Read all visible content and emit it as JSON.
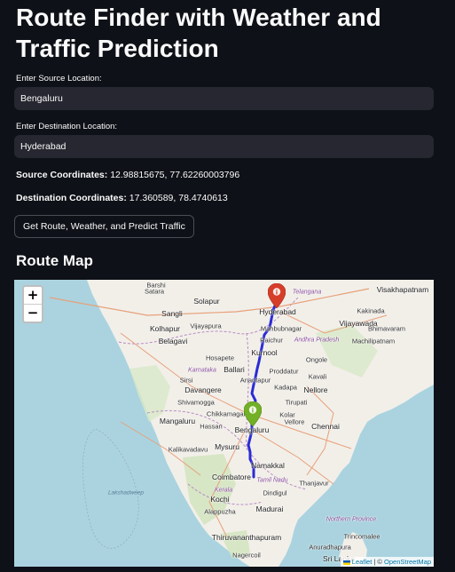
{
  "header": {
    "title": "Route Finder with Weather and Traffic Prediction"
  },
  "source": {
    "label": "Enter Source Location:",
    "value": "Bengaluru"
  },
  "destination": {
    "label": "Enter Destination Location:",
    "value": "Hyderabad"
  },
  "coordinates": {
    "source_label": "Source Coordinates:",
    "source_value": "12.98815675, 77.62260003796",
    "destination_label": "Destination Coordinates:",
    "destination_value": "17.360589, 78.4740613"
  },
  "action_button": {
    "label": "Get Route, Weather, and Predict Traffic"
  },
  "map_section": {
    "heading": "Route Map",
    "zoom_in": "+",
    "zoom_out": "−",
    "attribution": {
      "leaflet": "Leaflet",
      "separator": " | © ",
      "osm": "OpenStreetMap"
    },
    "start_marker_color": "#72b026",
    "end_marker_color": "#d63e2a",
    "route_color": "#2b2bd6",
    "places": {
      "barshi": "Barshi",
      "satara": "Satara",
      "telangana": "Telangana",
      "visakhapatnam": "Visakhapatnam",
      "solapur": "Solapur",
      "hyderabad": "Hyderabad",
      "sangli": "Sangli",
      "kakinada": "Kakinada",
      "kolhapur": "Kolhapur",
      "vijayapura": "Vijayapura",
      "mahbubnagar": "Mahbubnagar",
      "vijayawada": "Vijayawada",
      "bhimavaram": "Bhimavaram",
      "belagavi": "Belagavi",
      "raichur": "Raichur",
      "andhra_pradesh": "Andhra Pradesh",
      "machilipatnam": "Machilipatnam",
      "kurnool": "Kurnool",
      "hosapete": "Hosapete",
      "ongole": "Ongole",
      "karnataka": "Karnataka",
      "ballari": "Ballari",
      "proddatur": "Proddatur",
      "sirsi": "Sirsi",
      "kavali": "Kavali",
      "anantapur": "Anantapur",
      "davangere": "Davangere",
      "kadapa": "Kadapa",
      "nellore": "Nellore",
      "shivamogga": "Shivamogga",
      "tirupati": "Tirupati",
      "mangaluru": "Mangaluru",
      "chikkamagaluru": "Chikkamagaluru",
      "kolar": "Kolar",
      "vellore": "Vellore",
      "hassan": "Hassan",
      "bengaluru": "Bengaluru",
      "chennai": "Chennai",
      "mysuru": "Mysuru",
      "kalikavadavu": "Kalikavadavu",
      "namakkal": "Namakkal",
      "coimbatore": "Coimbatore",
      "tamil_nadu": "Tamil Nadu",
      "thanjavur": "Thanjavur",
      "lakshadweep": "Lakshadweep",
      "kerala": "Kerala",
      "dindigul": "Dindigul",
      "kochi": "Kochi",
      "madurai": "Madurai",
      "alappuzha": "Alappuzha",
      "northern_province": "Northern Province",
      "trincomalee": "Trincomalee",
      "thiruvananthapuram": "Thiruvananthapuram",
      "anuradhapura": "Anuradhapura",
      "nagercoil": "Nagercoil",
      "sri_lanka": "Sri Lanka"
    }
  }
}
